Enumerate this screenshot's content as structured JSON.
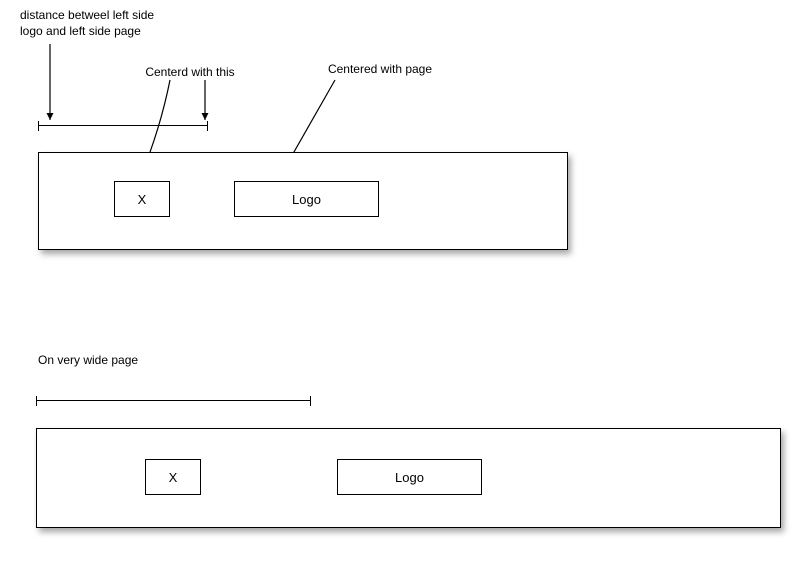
{
  "annotations": {
    "distance_label": "distance betweel left side\nlogo and left side page",
    "centered_with_this": "Centerd with this",
    "centered_with_page": "Centered  with page",
    "wide_page_label": "On very wide  page"
  },
  "boxes": {
    "x_label": "X",
    "logo_label": "Logo"
  }
}
